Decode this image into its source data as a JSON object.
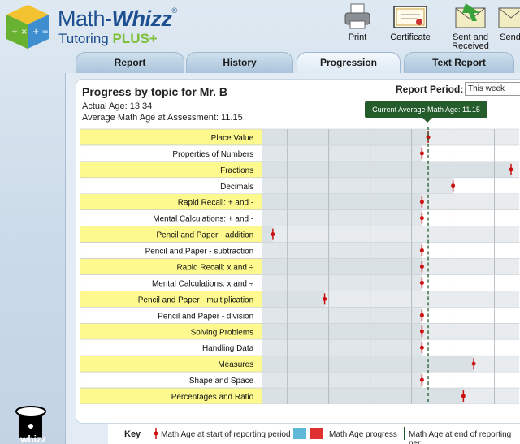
{
  "app": {
    "brand_part1": "Math-",
    "brand_part2": "Whizz",
    "brand_mark": "®",
    "subtitle_part1": "Tutoring ",
    "subtitle_part2": "PLUS+",
    "bottom_logo_text": "whizz"
  },
  "toolbar": {
    "print": "Print",
    "certificate": "Certificate",
    "sent_line1": "Sent and",
    "sent_line2": "Received Items",
    "send": "Send"
  },
  "tabs": [
    {
      "label": "Report",
      "active": false
    },
    {
      "label": "History",
      "active": false
    },
    {
      "label": "Progression",
      "active": true
    },
    {
      "label": "Text Report",
      "active": false
    }
  ],
  "report": {
    "title": "Progress by topic for Mr. B",
    "actual_age": "Actual Age: 13.34",
    "avg_math_age": "Average Math Age at Assessment: 11.15",
    "period_label": "Report Period:",
    "period_value": "This week",
    "current_avg_badge": "Current Average Math Age: 11.15"
  },
  "chart_data": {
    "type": "bar",
    "xlabel": "Math Age",
    "xlim": [
      7.15,
      13.35
    ],
    "ticks": [
      "7.75",
      "8.75",
      "9.75",
      "10.75",
      "11.75",
      "12.75"
    ],
    "tick_values": [
      7.75,
      8.75,
      9.75,
      10.75,
      11.75,
      12.75
    ],
    "current_average": 11.15,
    "topics": [
      {
        "label": "Place Value",
        "value": 11.15,
        "highlight": true
      },
      {
        "label": "Properties of Numbers",
        "value": 11.0,
        "highlight": false
      },
      {
        "label": "Fractions",
        "value": 13.15,
        "highlight": true
      },
      {
        "label": "Decimals",
        "value": 11.75,
        "highlight": false
      },
      {
        "label": "Rapid Recall: + and -",
        "value": 11.0,
        "highlight": true
      },
      {
        "label": "Mental Calculations: + and -",
        "value": 11.0,
        "highlight": false
      },
      {
        "label": "Pencil and Paper - addition",
        "value": 7.4,
        "highlight": true
      },
      {
        "label": "Pencil and Paper - subtraction",
        "value": 11.0,
        "highlight": false
      },
      {
        "label": "Rapid Recall: x and ÷",
        "value": 11.0,
        "highlight": true
      },
      {
        "label": "Mental Calculations: x and ÷",
        "value": 11.0,
        "highlight": false
      },
      {
        "label": "Pencil and Paper - multiplication",
        "value": 8.65,
        "highlight": true
      },
      {
        "label": "Pencil and Paper - division",
        "value": 11.0,
        "highlight": false
      },
      {
        "label": "Solving Problems",
        "value": 11.0,
        "highlight": true
      },
      {
        "label": "Handling Data",
        "value": 11.0,
        "highlight": false
      },
      {
        "label": "Measures",
        "value": 12.25,
        "highlight": true
      },
      {
        "label": "Shape and Space",
        "value": 11.0,
        "highlight": false
      },
      {
        "label": "Percentages and Ratio",
        "value": 12.0,
        "highlight": true
      }
    ]
  },
  "key": {
    "title": "Key",
    "start": "Math Age at start of reporting period",
    "progress": "Math Age progress",
    "end": "Math Age at end of reporting per"
  },
  "colors": {
    "highlight_row": "#fdf98f",
    "band": "#d6dee2",
    "marker": "#cc1111",
    "current_line": "#1f5a2a"
  }
}
